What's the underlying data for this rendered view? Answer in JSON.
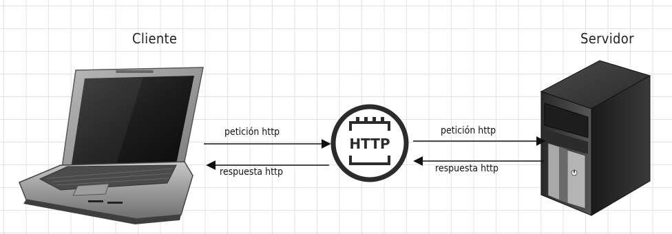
{
  "diagram": {
    "client_label": "Cliente",
    "server_label": "Servidor",
    "request_label_left": "petición http",
    "response_label_left": "respuesta http",
    "request_label_right": "petición http",
    "response_label_right": "respuesta http",
    "hub_text": "HTTP"
  }
}
